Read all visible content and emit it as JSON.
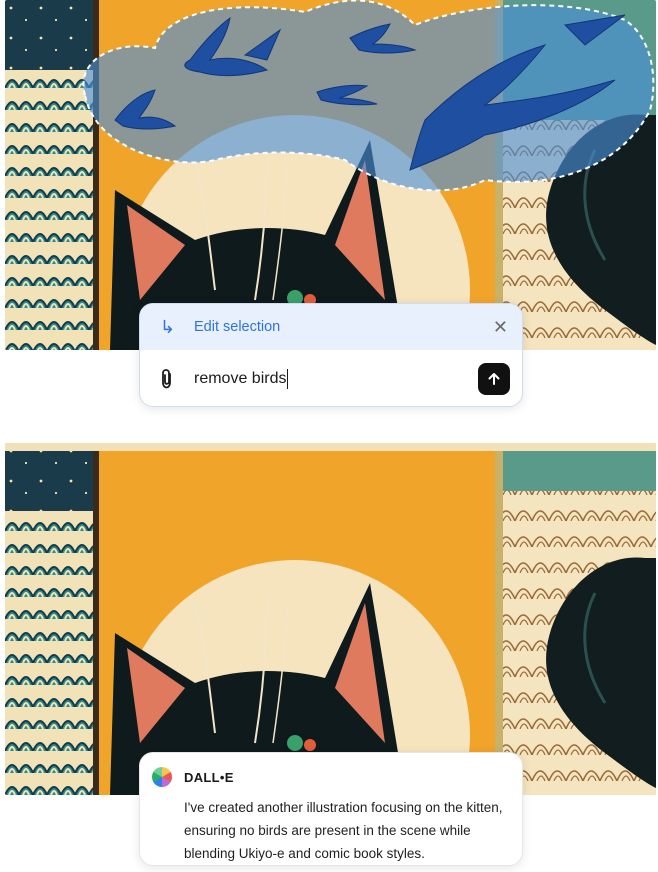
{
  "edit_box": {
    "title": "Edit selection",
    "input_text": "remove birds",
    "arrow_icon": "corner-down-right-icon",
    "close_icon": "close-icon",
    "attach_icon": "paperclip-icon",
    "send_icon": "arrow-up-icon",
    "accent_color": "#2f73e0"
  },
  "response": {
    "sender": "DALL•E",
    "message": "I've created another illustration focusing on the kitten, ensuring no birds are present in the scene while blending Ukiyo-e and comic book styles."
  },
  "images": {
    "before": "illustration-with-birds-selected",
    "after": "illustration-without-birds"
  }
}
